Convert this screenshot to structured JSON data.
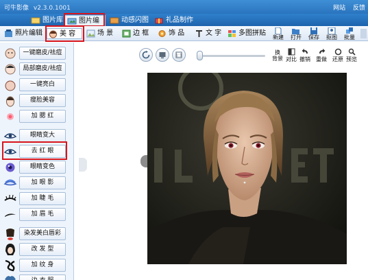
{
  "app": {
    "title": "可牛影像",
    "version": "v2.3.0.1001",
    "links": [
      "网站",
      "反馈"
    ]
  },
  "main_tabs": [
    {
      "label": "图片库",
      "active": false
    },
    {
      "label": "图片编辑",
      "active": true
    },
    {
      "label": "动感闪图",
      "active": false
    },
    {
      "label": "礼品制作",
      "active": false
    }
  ],
  "toolbar": {
    "tools": [
      {
        "label": "照片编辑",
        "icon": "photo-edit-icon",
        "active": false
      },
      {
        "label": "美 容",
        "icon": "beauty-face-icon",
        "active": true
      },
      {
        "label": "场 景",
        "icon": "scene-icon",
        "active": false
      },
      {
        "label": "边 框",
        "icon": "frame-icon",
        "active": false
      },
      {
        "label": "饰 品",
        "icon": "accessory-icon",
        "active": false
      },
      {
        "label": "文 字",
        "icon": "text-icon",
        "active": false
      },
      {
        "label": "多图拼贴",
        "icon": "collage-icon",
        "active": false
      }
    ],
    "buttons": [
      {
        "label": "新建",
        "icon": "new-icon"
      },
      {
        "label": "打开",
        "icon": "open-icon"
      },
      {
        "label": "保存",
        "icon": "save-icon"
      },
      {
        "label": "抠图",
        "icon": "cutout-icon"
      },
      {
        "label": "批量",
        "icon": "batch-icon"
      }
    ]
  },
  "effects": [
    {
      "label": "一键磨皮/祛痘",
      "icon": "smooth-skin-icon",
      "active": false
    },
    {
      "label": "局部磨皮/祛痘",
      "icon": "partial-smooth-icon",
      "active": false
    },
    {
      "label": "一键亮白",
      "icon": "whiten-icon",
      "active": false
    },
    {
      "label": "瘦脸美容",
      "icon": "slim-face-icon",
      "active": false
    },
    {
      "label": "加 腮 红",
      "icon": "blush-icon",
      "active": false
    },
    {
      "label": "眼睛变大",
      "icon": "enlarge-eye-icon",
      "active": false
    },
    {
      "label": "去 红 眼",
      "icon": "red-eye-icon",
      "active": true
    },
    {
      "label": "眼睛变色",
      "icon": "eye-color-icon",
      "active": false
    },
    {
      "label": "加 眼 影",
      "icon": "eye-shadow-icon",
      "active": false
    },
    {
      "label": "加 睫 毛",
      "icon": "eyelash-icon",
      "active": false
    },
    {
      "label": "加 眉 毛",
      "icon": "eyebrow-icon",
      "active": false
    },
    {
      "label": "染发美白唇彩",
      "icon": "hair-dye-icon",
      "active": false
    },
    {
      "label": "改 发 型",
      "icon": "hairstyle-icon",
      "active": false
    },
    {
      "label": "加 纹 身",
      "icon": "tattoo-icon",
      "active": false
    },
    {
      "label": "边 衣 服",
      "icon": "clothes-icon",
      "active": false
    }
  ],
  "view_tools": [
    {
      "label": "换\n背景",
      "icon": "background-icon"
    },
    {
      "label": "对比",
      "icon": "compare-icon"
    },
    {
      "label": "撤销",
      "icon": "undo-icon"
    },
    {
      "label": "重做",
      "icon": "redo-icon"
    },
    {
      "label": "还原",
      "icon": "restore-icon"
    },
    {
      "label": "预览",
      "icon": "preview-icon"
    }
  ],
  "view_round_buttons": [
    {
      "icon": "rotate-icon"
    },
    {
      "icon": "fit-screen-icon"
    },
    {
      "icon": "actual-size-icon"
    }
  ],
  "zoom_slider": {
    "value": 0.0
  },
  "colors": {
    "titlebar": "#2a74be",
    "highlight": "#d8141c",
    "panel": "#eef4fb"
  }
}
